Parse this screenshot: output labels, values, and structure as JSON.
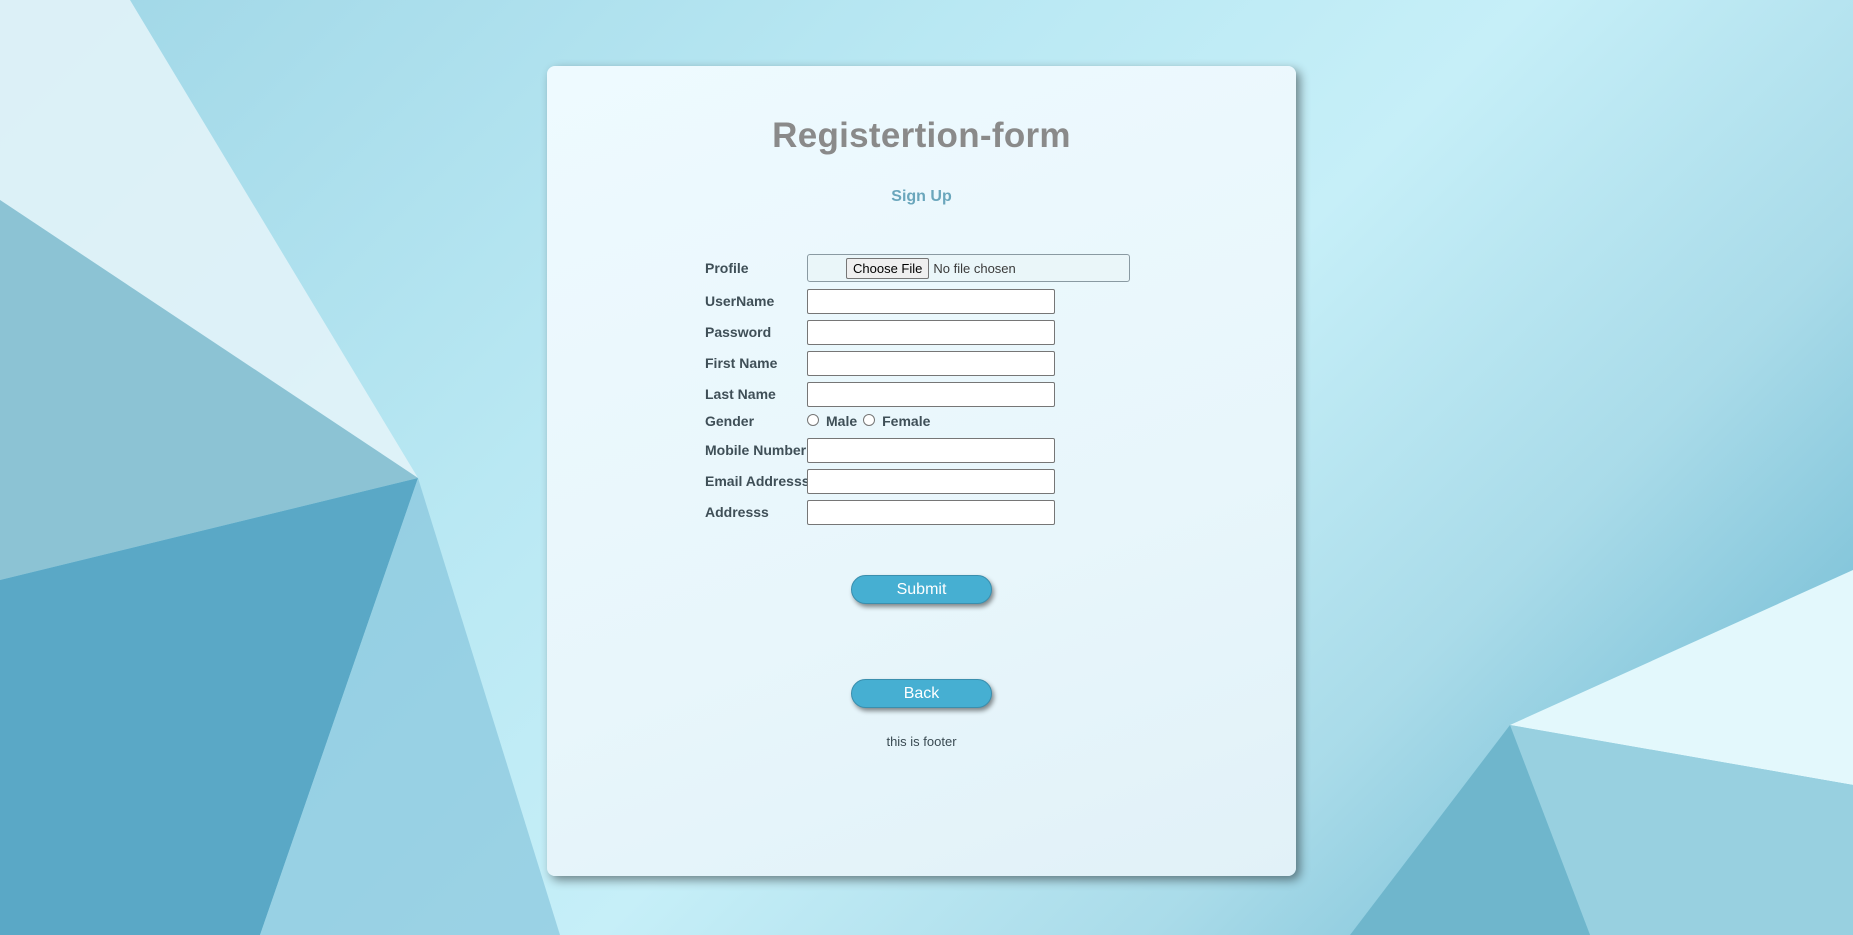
{
  "page": {
    "title": "Registertion-form",
    "subtitle": "Sign Up",
    "footer": "this is footer"
  },
  "form": {
    "profile_label": "Profile",
    "file_button": "Choose File",
    "file_status": "No file chosen",
    "username_label": "UserName",
    "username_value": "",
    "password_label": "Password",
    "password_value": "",
    "firstname_label": "First Name",
    "firstname_value": "",
    "lastname_label": "Last Name",
    "lastname_value": "",
    "gender_label": "Gender",
    "gender_options": [
      "Male",
      "Female"
    ],
    "gender_selected": "",
    "mobile_label": "Mobile Number",
    "mobile_value": "",
    "email_label": "Email Addresss",
    "email_value": "",
    "address_label": "Addresss",
    "address_value": ""
  },
  "buttons": {
    "submit": "Submit",
    "back": "Back"
  },
  "colors": {
    "accent": "#46afd2",
    "title": "#8a8a8a",
    "subtitle": "#6aa6bc"
  }
}
